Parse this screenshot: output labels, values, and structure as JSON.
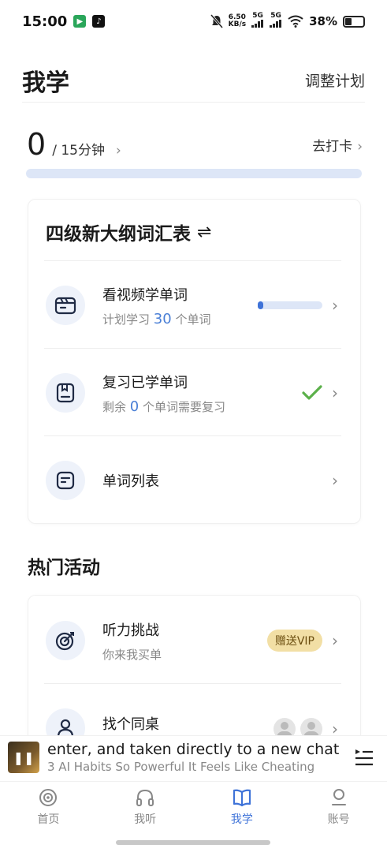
{
  "status_bar": {
    "time": "15:00",
    "net_speed_value": "6.50",
    "net_speed_unit": "KB/s",
    "sig1": "5G",
    "sig2": "5G",
    "battery": "38%"
  },
  "header": {
    "title": "我学",
    "adjust_label": "调整计划"
  },
  "summary": {
    "minutes_done": "0",
    "goal": "/ 15分钟",
    "checkin_label": "去打卡",
    "progress": 0
  },
  "wordbook": {
    "title": "四级新大纲词汇表",
    "swap_icon": "⇌",
    "rows": [
      {
        "title": "看视频学单词",
        "sub_pre": "计划学习",
        "sub_num": "30",
        "sub_post": "个单词",
        "progress": 0.08
      },
      {
        "title": "复习已学单词",
        "sub_pre": "剩余",
        "sub_num": "0",
        "sub_post": "个单词需要复习"
      },
      {
        "title": "单词列表"
      }
    ]
  },
  "hot": {
    "title": "热门活动",
    "rows": [
      {
        "title": "听力挑战",
        "sub": "你来我买单",
        "badge": "赠送VIP"
      },
      {
        "title": "找个同桌"
      }
    ]
  },
  "player": {
    "line1": "enter, and taken directly to a new chat GP",
    "line2": "3 AI Habits So Powerful It Feels Like Cheating"
  },
  "tabs": [
    {
      "label": "首页",
      "icon": "home-icon"
    },
    {
      "label": "我听",
      "icon": "headphones-icon"
    },
    {
      "label": "我学",
      "icon": "book-icon"
    },
    {
      "label": "账号",
      "icon": "account-icon"
    }
  ],
  "colors": {
    "accent": "#3f73d8",
    "track": "#dde6f7",
    "check": "#5bb04a",
    "vip_badge": "#f2dfa5"
  }
}
